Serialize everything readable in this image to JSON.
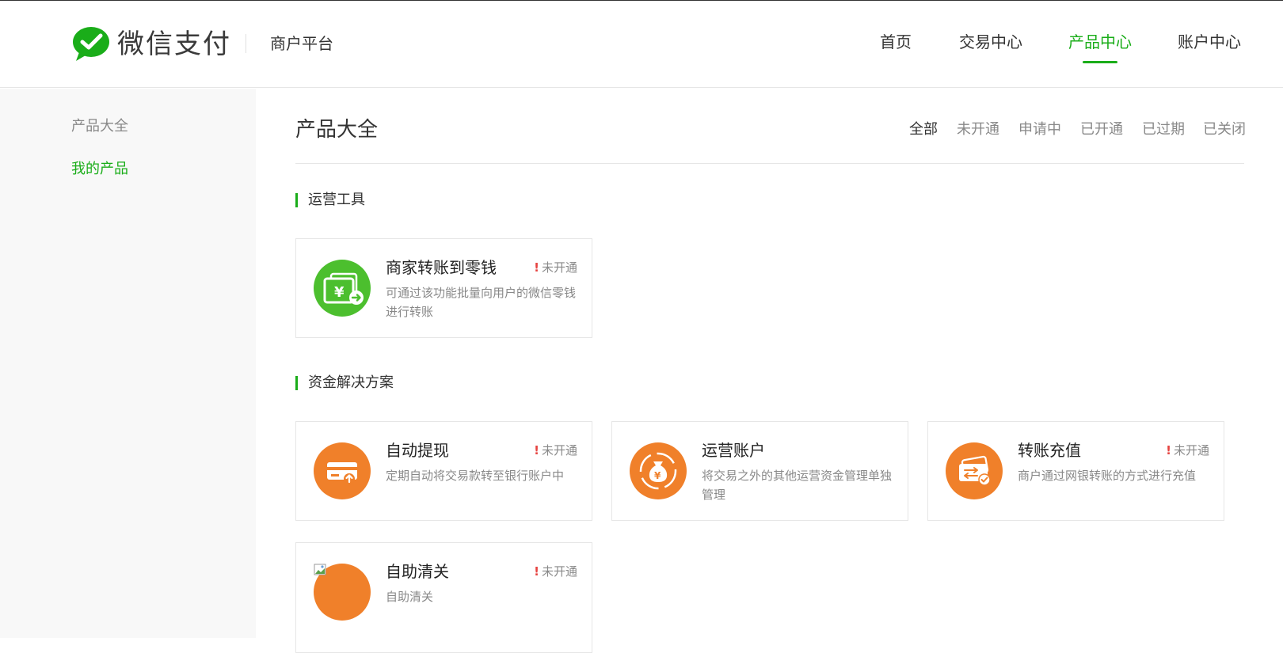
{
  "brand": {
    "logo_text": "微信支付",
    "platform": "商户平台",
    "accent": "#1aad19"
  },
  "nav": {
    "items": [
      "首页",
      "交易中心",
      "产品中心",
      "账户中心"
    ],
    "active": "产品中心"
  },
  "sidebar": {
    "items": [
      "产品大全",
      "我的产品"
    ],
    "active": "我的产品"
  },
  "main": {
    "title": "产品大全",
    "filters": [
      "全部",
      "未开通",
      "申请中",
      "已开通",
      "已过期",
      "已关闭"
    ],
    "active_filter": "全部"
  },
  "sections": [
    {
      "title": "运营工具",
      "cards": [
        {
          "name": "商家转账到零钱",
          "status": "未开通",
          "desc": "可通过该功能批量向用户的微信零钱进行转账",
          "icon": "wallet-transfer-icon",
          "icon_color": "#4cbf2e"
        }
      ]
    },
    {
      "title": "资金解决方案",
      "cards": [
        {
          "name": "自动提现",
          "status": "未开通",
          "desc": "定期自动将交易款转至银行账户中",
          "icon": "card-withdraw-icon",
          "icon_color": "#f0802a"
        },
        {
          "name": "运营账户",
          "status": "",
          "desc": "将交易之外的其他运营资金管理单独管理",
          "icon": "money-bag-icon",
          "icon_color": "#f0802a"
        },
        {
          "name": "转账充值",
          "status": "未开通",
          "desc": "商户通过网银转账的方式进行充值",
          "icon": "card-recharge-icon",
          "icon_color": "#f0802a"
        },
        {
          "name": "自助清关",
          "status": "未开通",
          "desc": "自助清关",
          "icon": "broken-image-icon",
          "icon_color": "#f0802a"
        }
      ]
    }
  ]
}
